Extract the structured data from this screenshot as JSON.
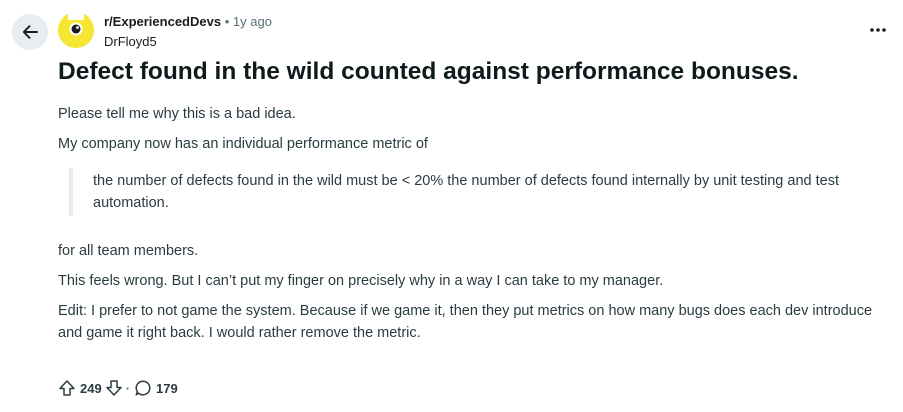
{
  "post": {
    "subreddit": "r/ExperiencedDevs",
    "separator": "•",
    "age": "1y ago",
    "author": "DrFloyd5",
    "title": "Defect found in the wild counted against performance bonuses.",
    "body": {
      "p1": "Please tell me why this is a bad idea.",
      "p2": "My company now has an individual performance metric of",
      "quote": "the number of defects found in the wild must be < 20% the number of defects found internally by unit testing and test automation.",
      "p3": "for all team members.",
      "p4": "This feels wrong. But I can’t put my finger on precisely why in a way I can take to my manager.",
      "p5": "Edit: I prefer to not game the system. Because if we game it, then they put metrics on how many bugs does each dev introduce and game it right back. I would rather remove the metric."
    },
    "actions": {
      "score": "249",
      "separator": "·",
      "comments": "179"
    }
  },
  "icons": {
    "back": "arrow-left-icon",
    "avatar": "subreddit-avatar",
    "more": "more-horizontal-icon",
    "upvote": "upvote-arrow-icon",
    "downvote": "downvote-arrow-icon",
    "comment": "comment-bubble-icon"
  },
  "colors": {
    "avatar_background": "#f5e633",
    "back_button_background": "#e9edef",
    "meta_gray": "#576f76",
    "quote_border": "#e5ebee",
    "title_text": "#0f1a1c",
    "body_text": "#2a3c42"
  }
}
